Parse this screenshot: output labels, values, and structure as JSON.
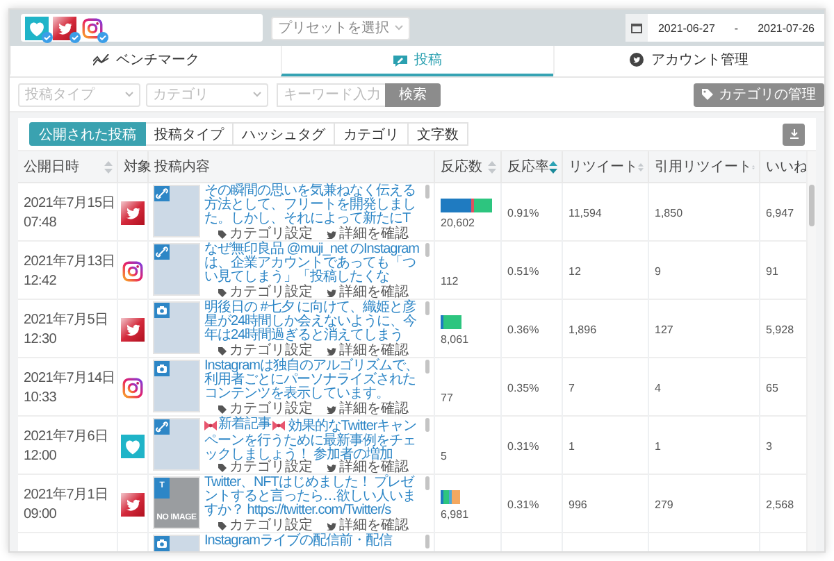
{
  "account_bar": {
    "accounts": [
      {
        "kind": "heart",
        "verified": true
      },
      {
        "kind": "twitter",
        "verified": true
      },
      {
        "kind": "instagram",
        "verified": true
      }
    ],
    "preset": {
      "placeholder": "プリセットを選択"
    },
    "date_range": {
      "start": "2021-06-27",
      "separator": "-",
      "end": "2021-07-26"
    }
  },
  "tabs": [
    {
      "label": "ベンチマーク",
      "kind": "chart",
      "selected": false
    },
    {
      "label": "投稿",
      "kind": "edit",
      "selected": true
    },
    {
      "label": "アカウント管理",
      "kind": "twitter",
      "selected": false
    }
  ],
  "filters": {
    "post_type": {
      "placeholder": "投稿タイプ"
    },
    "category": {
      "placeholder": "カテゴリ"
    },
    "keyword": {
      "placeholder": "キーワード入力"
    },
    "search_button": "検索",
    "manage_button": "カテゴリの管理"
  },
  "subtabs": [
    {
      "label": "公開された投稿",
      "selected": true
    },
    {
      "label": "投稿タイプ",
      "selected": false
    },
    {
      "label": "ハッシュタグ",
      "selected": false
    },
    {
      "label": "カテゴリ",
      "selected": false
    },
    {
      "label": "文字数",
      "selected": false
    }
  ],
  "table": {
    "columns": [
      {
        "label": "公開日時",
        "sortable": true,
        "sorted": false
      },
      {
        "label": "対象",
        "sortable": false
      },
      {
        "label": "投稿内容",
        "sortable": false
      },
      {
        "label": "反応数",
        "sortable": true,
        "sorted": false
      },
      {
        "label": "反応率",
        "sortable": true,
        "sorted": true
      },
      {
        "label": "リツイート",
        "sortable": true,
        "sorted": false
      },
      {
        "label": "引用リツイート",
        "sortable": true,
        "sorted": false
      },
      {
        "label": "いいね",
        "sortable": false
      }
    ],
    "rows": [
      {
        "date": "2021年7月15日",
        "time": "07:48",
        "platform": {
          "kind": "twitter"
        },
        "thumb": {
          "kind": "photo"
        },
        "badge": {
          "kind": "link"
        },
        "text": "その瞬間の思いを気兼ねなく伝える方法として、フリートを開発しました。しかし、それによって新たにT",
        "actions": [
          "カテゴリ設定",
          "詳細を確認"
        ],
        "bar": [
          {
            "color": "#1f7bc1",
            "kind": "wide"
          },
          {
            "color": "#e0505e",
            "kind": "thin"
          },
          {
            "color": "#2dc57f",
            "kind": "medium"
          }
        ],
        "reactions": "20,602",
        "rate": "0.91%",
        "retweets": "11,594",
        "quotes": "1,850",
        "likes": "6,947"
      },
      {
        "date": "2021年7月13日",
        "time": "12:42",
        "platform": {
          "kind": "instagram"
        },
        "thumb": {
          "kind": "photo"
        },
        "badge": {
          "kind": "link"
        },
        "text": "なぜ無印良品 @muji_net のInstagramは、企業アカウントであっても「つい見てしまう」「投稿したくな",
        "actions": [
          "カテゴリ設定",
          "詳細を確認"
        ],
        "reactions": "112",
        "rate": "0.51%",
        "retweets": "12",
        "quotes": "9",
        "likes": "91"
      },
      {
        "date": "2021年7月5日",
        "time": "12:30",
        "platform": {
          "kind": "twitter"
        },
        "thumb": {
          "kind": "photo"
        },
        "badge": {
          "kind": "camera"
        },
        "text": "明後日の #七夕 に向けて、織姫と彦星が24時間しか会えないように、今年は24時間過ぎると消えてしまう",
        "actions": [
          "カテゴリ設定",
          "詳細を確認"
        ],
        "bar": [
          {
            "color": "#1f7bc1",
            "kind": "thin"
          },
          {
            "color": "#2dc57f",
            "kind": "medium"
          }
        ],
        "reactions": "8,061",
        "rate": "0.36%",
        "retweets": "1,896",
        "quotes": "127",
        "likes": "5,928"
      },
      {
        "date": "2021年7月14日",
        "time": "10:33",
        "platform": {
          "kind": "instagram"
        },
        "thumb": {
          "kind": "photo"
        },
        "badge": {
          "kind": "camera"
        },
        "text": "Instagramは独自のアルゴリズムで、利用者ごとにパーソナライズされたコンテンツを表示しています。",
        "actions": [
          "カテゴリ設定",
          "詳細を確認"
        ],
        "reactions": "77",
        "rate": "0.35%",
        "retweets": "7",
        "quotes": "4",
        "likes": "65"
      },
      {
        "date": "2021年7月6日",
        "time": "12:00",
        "platform": {
          "kind": "heart"
        },
        "thumb": {
          "kind": "photo"
        },
        "badge": {
          "kind": "link"
        },
        "tag": "新着記事",
        "text": "効果的なTwitterキャンペーンを行うために最新事例をチェックしましょう！ 参加者の増加",
        "actions": [
          "カテゴリ設定",
          "詳細を確認"
        ],
        "reactions": "5",
        "rate": "0.31%",
        "retweets": "1",
        "quotes": "1",
        "likes": "3"
      },
      {
        "date": "2021年7月1日",
        "time": "09:00",
        "platform": {
          "kind": "twitter"
        },
        "thumb": {
          "kind": "no_image",
          "label": "NO IMAGE"
        },
        "badge": {
          "kind": "text",
          "label": "T"
        },
        "text": "Twitter、NFTはじめました！ プレゼントすると言ったら…欲しい人いますか？ https://twitter.com/Twitter/s",
        "actions": [
          "カテゴリ設定",
          "詳細を確認"
        ],
        "bar": [
          {
            "color": "#1f7bc1",
            "kind": "thin"
          },
          {
            "color": "#2dc57f",
            "kind": "small"
          },
          {
            "color": "#4fa8d6",
            "kind": "thin"
          },
          {
            "color": "#f4a860",
            "kind": "narrow"
          }
        ],
        "reactions": "6,981",
        "rate": "0.31%",
        "retweets": "996",
        "quotes": "279",
        "likes": "2,568"
      },
      {
        "thumb": {
          "kind": "photo"
        },
        "badge": {
          "kind": "camera"
        },
        "text": "Instagramライブの配信前・配信"
      }
    ]
  }
}
